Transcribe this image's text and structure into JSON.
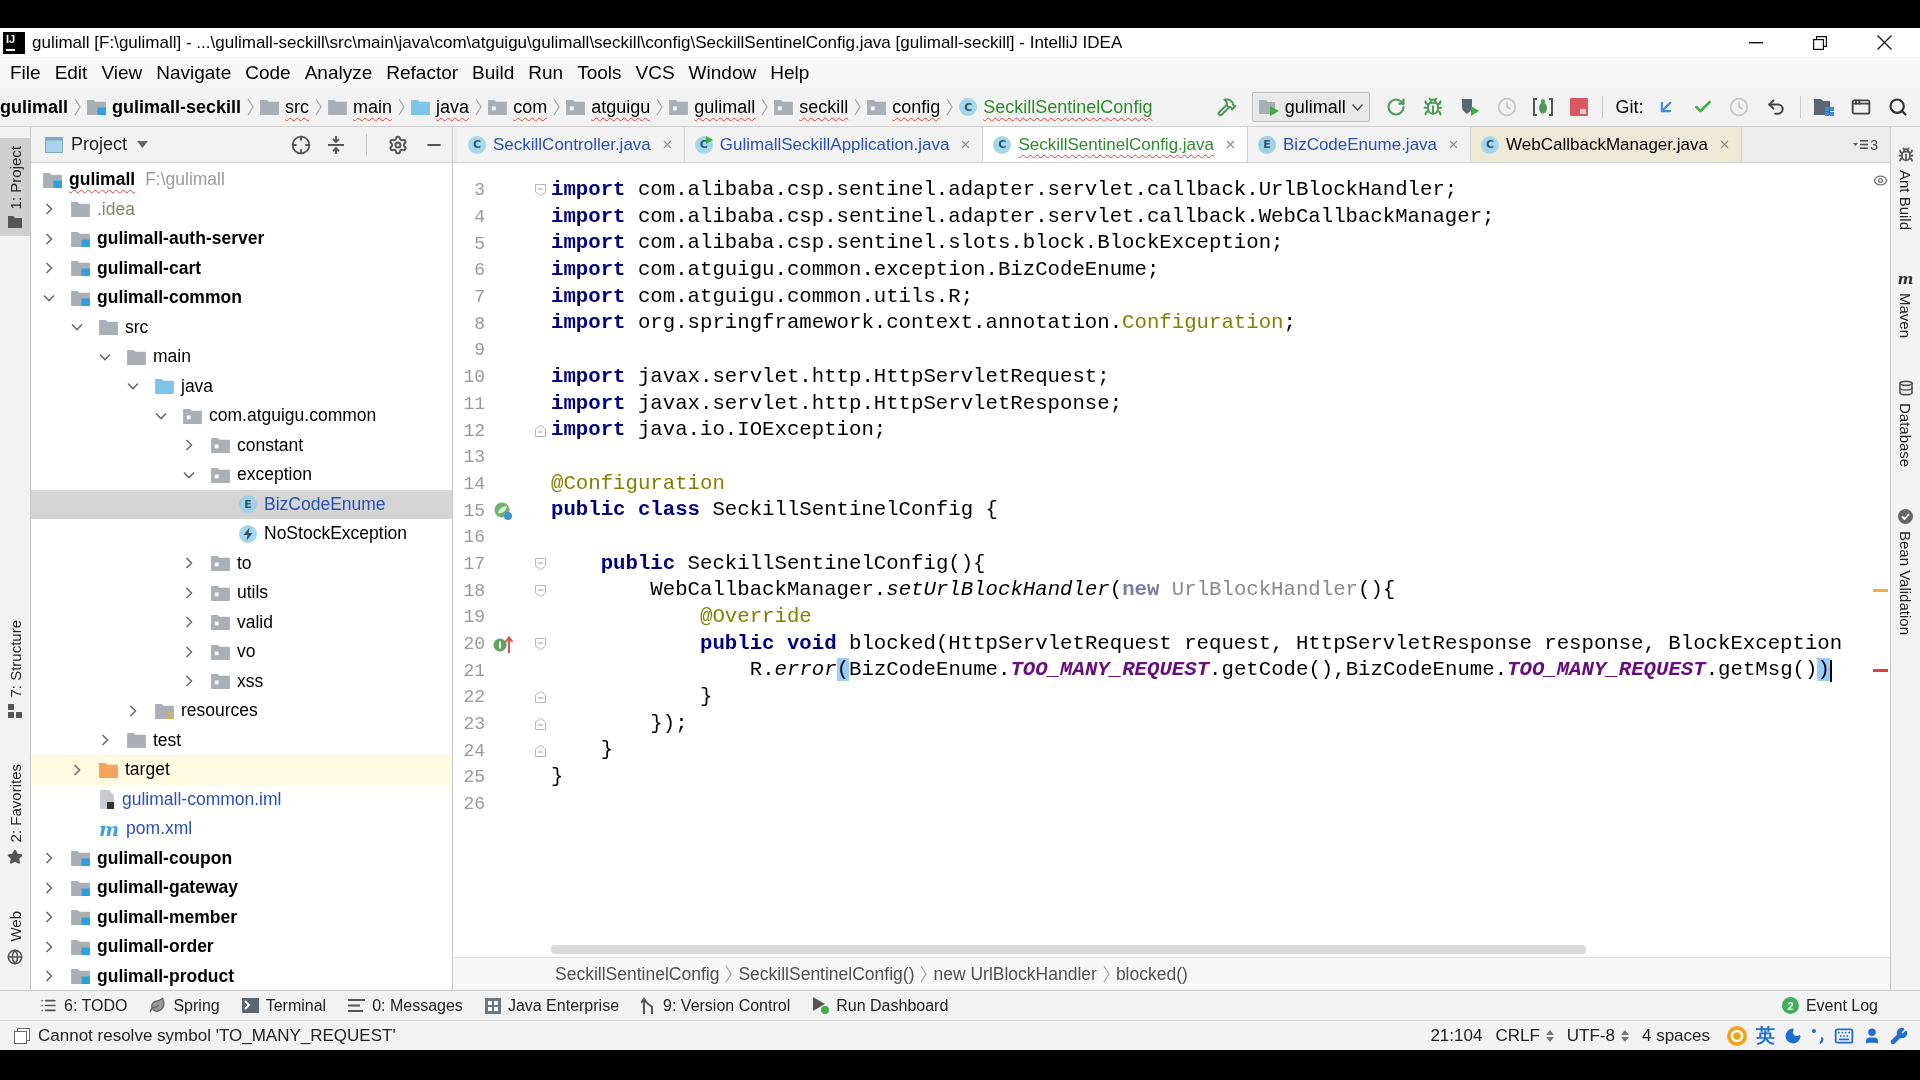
{
  "title_bar": {
    "app_logo": "IJ",
    "title": "gulimall [F:\\gulimall] - ...\\gulimall-seckill\\src\\main\\java\\com\\atguigu\\gulimall\\seckill\\config\\SeckillSentinelConfig.java [gulimall-seckill] - IntelliJ IDEA"
  },
  "menu": [
    "File",
    "Edit",
    "View",
    "Navigate",
    "Code",
    "Analyze",
    "Refactor",
    "Build",
    "Run",
    "Tools",
    "VCS",
    "Window",
    "Help"
  ],
  "navigation_bar": {
    "crumbs": [
      {
        "label": "gulimall",
        "kind": "project",
        "color": "#000000",
        "problem": false
      },
      {
        "label": "gulimall-seckill",
        "kind": "module",
        "color": "#000000",
        "problem": false
      },
      {
        "label": "src",
        "kind": "folder",
        "color": "#000000",
        "problem": true
      },
      {
        "label": "main",
        "kind": "folder",
        "color": "#000000",
        "problem": true
      },
      {
        "label": "java",
        "kind": "source_folder",
        "color": "#000000",
        "problem": true
      },
      {
        "label": "com",
        "kind": "package",
        "color": "#000000",
        "problem": true
      },
      {
        "label": "atguigu",
        "kind": "package",
        "color": "#000000",
        "problem": true
      },
      {
        "label": "gulimall",
        "kind": "package",
        "color": "#000000",
        "problem": true
      },
      {
        "label": "seckill",
        "kind": "package",
        "color": "#000000",
        "problem": true
      },
      {
        "label": "config",
        "kind": "package",
        "color": "#000000",
        "problem": true
      },
      {
        "label": "SeckillSentinelConfig",
        "kind": "class",
        "icon_letter": "C",
        "color": "#2e8b2e",
        "problem": true
      }
    ],
    "build_actions": [
      {
        "kind": "build",
        "disabled": false
      }
    ],
    "run_configuration": "gulimall",
    "run_actions": [
      {
        "kind": "rerun",
        "disabled": false
      },
      {
        "kind": "debug",
        "disabled": false
      },
      {
        "kind": "coverage",
        "disabled": false
      },
      {
        "kind": "profile",
        "disabled": true
      },
      {
        "kind": "attach_debugger",
        "disabled": false
      },
      {
        "kind": "stop",
        "disabled": false
      }
    ],
    "vcs_label": "Git:",
    "vcs_actions": [
      {
        "kind": "update",
        "disabled": false
      },
      {
        "kind": "commit",
        "disabled": false
      },
      {
        "kind": "history",
        "disabled": true
      },
      {
        "kind": "rollback",
        "disabled": false
      }
    ],
    "tool_actions": [
      {
        "kind": "project_structure",
        "disabled": false
      },
      {
        "kind": "presentation",
        "disabled": false
      },
      {
        "kind": "search",
        "disabled": false
      }
    ]
  },
  "left_tool_strip": {
    "top": [
      {
        "label": "1: Project",
        "kind": "project",
        "selected": true
      }
    ],
    "bottom": [
      {
        "label": "7: Structure",
        "kind": "structure",
        "selected": false
      },
      {
        "label": "2: Favorites",
        "kind": "favorites",
        "selected": false
      },
      {
        "label": "Web",
        "kind": "web",
        "selected": false
      }
    ]
  },
  "project_panel": {
    "title": "Project",
    "tree": [
      {
        "label": "gulimall",
        "hint": "F:\\gulimall",
        "kind": "module",
        "selected": false,
        "color": "#000000",
        "problem": true,
        "children": [
          {
            "label": ".idea",
            "kind": "folder",
            "expanded": false,
            "selected": false,
            "color": "#85856a"
          },
          {
            "label": "gulimall-auth-server",
            "kind": "module",
            "expanded": false,
            "selected": false,
            "color": "#000000"
          },
          {
            "label": "gulimall-cart",
            "kind": "module",
            "expanded": false,
            "selected": false,
            "color": "#000000"
          },
          {
            "label": "gulimall-common",
            "kind": "module",
            "expanded": true,
            "selected": false,
            "color": "#000000",
            "children": [
              {
                "label": "src",
                "kind": "folder",
                "expanded": true,
                "selected": false,
                "color": "#000000",
                "children": [
                  {
                    "label": "main",
                    "kind": "folder",
                    "expanded": true,
                    "selected": false,
                    "color": "#000000",
                    "children": [
                      {
                        "label": "java",
                        "kind": "source_folder",
                        "expanded": true,
                        "selected": false,
                        "color": "#000000",
                        "children": [
                          {
                            "label": "com.atguigu.common",
                            "kind": "package",
                            "expanded": true,
                            "selected": false,
                            "color": "#000000",
                            "children": [
                              {
                                "label": "constant",
                                "kind": "package",
                                "expanded": false,
                                "selected": false,
                                "color": "#000000"
                              },
                              {
                                "label": "exception",
                                "kind": "package",
                                "expanded": true,
                                "selected": false,
                                "color": "#000000",
                                "children": [
                                  {
                                    "label": "BizCodeEnume",
                                    "kind": "enum",
                                    "icon_letter": "E",
                                    "selected": true,
                                    "color": "#2950b8"
                                  },
                                  {
                                    "label": "NoStockException",
                                    "kind": "exception_class",
                                    "selected": false,
                                    "color": "#000000"
                                  }
                                ]
                              },
                              {
                                "label": "to",
                                "kind": "package",
                                "expanded": false,
                                "selected": false,
                                "color": "#000000"
                              },
                              {
                                "label": "utils",
                                "kind": "package",
                                "expanded": false,
                                "selected": false,
                                "color": "#000000"
                              },
                              {
                                "label": "valid",
                                "kind": "package",
                                "expanded": false,
                                "selected": false,
                                "color": "#000000"
                              },
                              {
                                "label": "vo",
                                "kind": "package",
                                "expanded": false,
                                "selected": false,
                                "color": "#000000"
                              },
                              {
                                "label": "xss",
                                "kind": "package",
                                "expanded": false,
                                "selected": false,
                                "color": "#000000"
                              }
                            ]
                          }
                        ]
                      },
                      {
                        "label": "resources",
                        "kind": "resource_folder",
                        "expanded": false,
                        "selected": false,
                        "color": "#000000"
                      }
                    ]
                  },
                  {
                    "label": "test",
                    "kind": "folder",
                    "expanded": false,
                    "selected": false,
                    "color": "#000000"
                  }
                ]
              },
              {
                "label": "target",
                "kind": "excluded_folder",
                "expanded": false,
                "selected": false,
                "color": "#000000"
              },
              {
                "label": "gulimall-common.iml",
                "kind": "iml_file",
                "selected": false,
                "color": "#2950b8"
              },
              {
                "label": "pom.xml",
                "kind": "maven_file",
                "icon_letter": "m",
                "selected": false,
                "color": "#2950b8"
              }
            ]
          },
          {
            "label": "gulimall-coupon",
            "kind": "module",
            "expanded": false,
            "selected": false,
            "color": "#000000"
          },
          {
            "label": "gulimall-gateway",
            "kind": "module",
            "expanded": false,
            "selected": false,
            "color": "#000000"
          },
          {
            "label": "gulimall-member",
            "kind": "module",
            "expanded": false,
            "selected": false,
            "color": "#000000"
          },
          {
            "label": "gulimall-order",
            "kind": "module",
            "expanded": false,
            "selected": false,
            "color": "#000000"
          },
          {
            "label": "gulimall-product",
            "kind": "module",
            "expanded": false,
            "selected": false,
            "color": "#000000"
          }
        ]
      }
    ]
  },
  "editor": {
    "tabs": [
      {
        "label": "SeckillController.java",
        "kind": "class",
        "icon_letter": "C",
        "color": "#2950b8",
        "library": false,
        "selected": false,
        "problem": false
      },
      {
        "label": "GulimallSeckillApplication.java",
        "kind": "runnable_class",
        "icon_letter": "C",
        "color": "#2950b8",
        "library": false,
        "selected": false,
        "problem": false
      },
      {
        "label": "SeckillSentinelConfig.java",
        "kind": "class",
        "icon_letter": "C",
        "color": "#2e8b2e",
        "library": false,
        "selected": true,
        "problem": true
      },
      {
        "label": "BizCodeEnume.java",
        "kind": "enum",
        "icon_letter": "E",
        "color": "#2950b8",
        "library": false,
        "selected": false,
        "problem": false
      },
      {
        "label": "WebCallbackManager.java",
        "kind": "class",
        "icon_letter": "C",
        "color": "#000000",
        "library": true,
        "selected": false,
        "problem": false
      }
    ],
    "hidden_tabs": "3",
    "lines": [
      {
        "number": "3",
        "markers": [
          {
            "kind": "fold_start"
          }
        ],
        "tokens": [
          {
            "text": "import",
            "kind": "keyword"
          },
          {
            "text": " com.alibaba.csp.sentinel.adapter.servlet.callback.UrlBlockHandler;",
            "kind": "plain"
          }
        ]
      },
      {
        "number": "4",
        "tokens": [
          {
            "text": "import",
            "kind": "keyword"
          },
          {
            "text": " com.alibaba.csp.sentinel.adapter.servlet.callback.WebCallbackManager;",
            "kind": "plain"
          }
        ]
      },
      {
        "number": "5",
        "tokens": [
          {
            "text": "import",
            "kind": "keyword"
          },
          {
            "text": " com.alibaba.csp.sentinel.slots.block.BlockException;",
            "kind": "plain"
          }
        ]
      },
      {
        "number": "6",
        "tokens": [
          {
            "text": "import",
            "kind": "keyword"
          },
          {
            "text": " com.atguigu.common.exception.BizCodeEnume;",
            "kind": "plain"
          }
        ]
      },
      {
        "number": "7",
        "tokens": [
          {
            "text": "import",
            "kind": "keyword"
          },
          {
            "text": " com.atguigu.common.utils.R;",
            "kind": "plain"
          }
        ]
      },
      {
        "number": "8",
        "tokens": [
          {
            "text": "import",
            "kind": "keyword"
          },
          {
            "text": " org.springframework.context.annotation.",
            "kind": "plain"
          },
          {
            "text": "Configuration",
            "kind": "annotation"
          },
          {
            "text": ";",
            "kind": "plain"
          }
        ]
      },
      {
        "number": "9"
      },
      {
        "number": "10",
        "tokens": [
          {
            "text": "import",
            "kind": "keyword"
          },
          {
            "text": " javax.servlet.http.HttpServletRequest;",
            "kind": "plain"
          }
        ]
      },
      {
        "number": "11",
        "tokens": [
          {
            "text": "import",
            "kind": "keyword"
          },
          {
            "text": " javax.servlet.http.HttpServletResponse;",
            "kind": "plain"
          }
        ]
      },
      {
        "number": "12",
        "markers": [
          {
            "kind": "fold_end"
          }
        ],
        "tokens": [
          {
            "text": "import",
            "kind": "keyword"
          },
          {
            "text": " java.io.IOException;",
            "kind": "plain"
          }
        ]
      },
      {
        "number": "13"
      },
      {
        "number": "14",
        "tokens": [
          {
            "text": "@Configuration",
            "kind": "annotation"
          }
        ]
      },
      {
        "number": "15",
        "markers": [
          {
            "kind": "spring_bean"
          }
        ],
        "tokens": [
          {
            "text": "public class",
            "kind": "keyword"
          },
          {
            "text": " SeckillSentinelConfig {",
            "kind": "plain"
          }
        ]
      },
      {
        "number": "16"
      },
      {
        "number": "17",
        "markers": [
          {
            "kind": "fold_start"
          }
        ],
        "tokens": [
          {
            "text": "    public",
            "kind": "keyword"
          },
          {
            "text": " SeckillSentinelConfig(){",
            "kind": "plain"
          }
        ]
      },
      {
        "number": "18",
        "markers": [
          {
            "kind": "fold_start"
          },
          {
            "kind": "warning_stripe"
          }
        ],
        "tokens": [
          {
            "text": "        WebCallbackManager.",
            "kind": "plain"
          },
          {
            "text": "setUrlBlockHandler",
            "kind": "static_method"
          },
          {
            "text": "(",
            "kind": "plain"
          },
          {
            "text": "new",
            "kind": "muted_keyword"
          },
          {
            "text": " UrlBlockHandler",
            "kind": "muted"
          },
          {
            "text": "(){",
            "kind": "plain"
          }
        ]
      },
      {
        "number": "19",
        "tokens": [
          {
            "text": "            @Override",
            "kind": "annotation"
          }
        ]
      },
      {
        "number": "20",
        "markers": [
          {
            "kind": "implements"
          },
          {
            "kind": "fold_start"
          }
        ],
        "tokens": [
          {
            "text": "            public void",
            "kind": "keyword"
          },
          {
            "text": " blocked(HttpServletRequest request, HttpServletResponse response, BlockException",
            "kind": "plain"
          }
        ]
      },
      {
        "number": "21",
        "markers": [
          {
            "kind": "caret"
          },
          {
            "kind": "error_stripe"
          }
        ],
        "tokens": [
          {
            "text": "                R.",
            "kind": "plain"
          },
          {
            "text": "error",
            "kind": "static_method"
          },
          {
            "text": "(",
            "kind": "matched_bracket"
          },
          {
            "text": "BizCodeEnume.",
            "kind": "plain"
          },
          {
            "text": "TOO_MANY_REQUEST",
            "kind": "constant"
          },
          {
            "text": ".getCode(),BizCodeEnume.",
            "kind": "plain"
          },
          {
            "text": "TOO_MANY_REQUEST",
            "kind": "constant"
          },
          {
            "text": ".getMsg()",
            "kind": "plain"
          },
          {
            "text": ")",
            "kind": "matched_bracket"
          }
        ]
      },
      {
        "number": "22",
        "markers": [
          {
            "kind": "fold_end"
          }
        ],
        "tokens": [
          {
            "text": "            }",
            "kind": "plain"
          }
        ]
      },
      {
        "number": "23",
        "markers": [
          {
            "kind": "fold_end"
          }
        ],
        "tokens": [
          {
            "text": "        });",
            "kind": "plain"
          }
        ]
      },
      {
        "number": "24",
        "markers": [
          {
            "kind": "fold_end"
          }
        ],
        "tokens": [
          {
            "text": "    }",
            "kind": "plain"
          }
        ]
      },
      {
        "number": "25",
        "tokens": [
          {
            "text": "}",
            "kind": "plain"
          }
        ]
      },
      {
        "number": "26"
      }
    ],
    "breadcrumbs": [
      "SeckillSentinelConfig",
      "SeckillSentinelConfig()",
      "new UrlBlockHandler",
      "blocked()"
    ]
  },
  "right_tool_strip": [
    {
      "label": "Ant Build",
      "kind": "ant",
      "selected": false
    },
    {
      "label": "Maven",
      "kind": "maven",
      "icon_letter": "m",
      "selected": false
    },
    {
      "label": "Database",
      "kind": "database",
      "selected": false
    },
    {
      "label": "Bean Validation",
      "kind": "bean_validation",
      "selected": false
    }
  ],
  "tool_window_bar": {
    "items": [
      {
        "label": "6: TODO",
        "kind": "todo"
      },
      {
        "label": "Spring",
        "kind": "spring"
      },
      {
        "label": "Terminal",
        "kind": "terminal"
      },
      {
        "label": "0: Messages",
        "kind": "messages"
      },
      {
        "label": "Java Enterprise",
        "kind": "java_enterprise"
      },
      {
        "label": "9: Version Control",
        "kind": "version_control"
      },
      {
        "label": "Run Dashboard",
        "kind": "run_dashboard"
      }
    ],
    "event_log": {
      "label": "Event Log",
      "count": "2"
    }
  },
  "status_bar": {
    "message": "Cannot resolve symbol 'TO_MANY_REQUEST'",
    "position": "21:104",
    "line_separator": "CRLF",
    "encoding": "UTF-8",
    "indent": "4 spaces",
    "input_language": "英"
  }
}
